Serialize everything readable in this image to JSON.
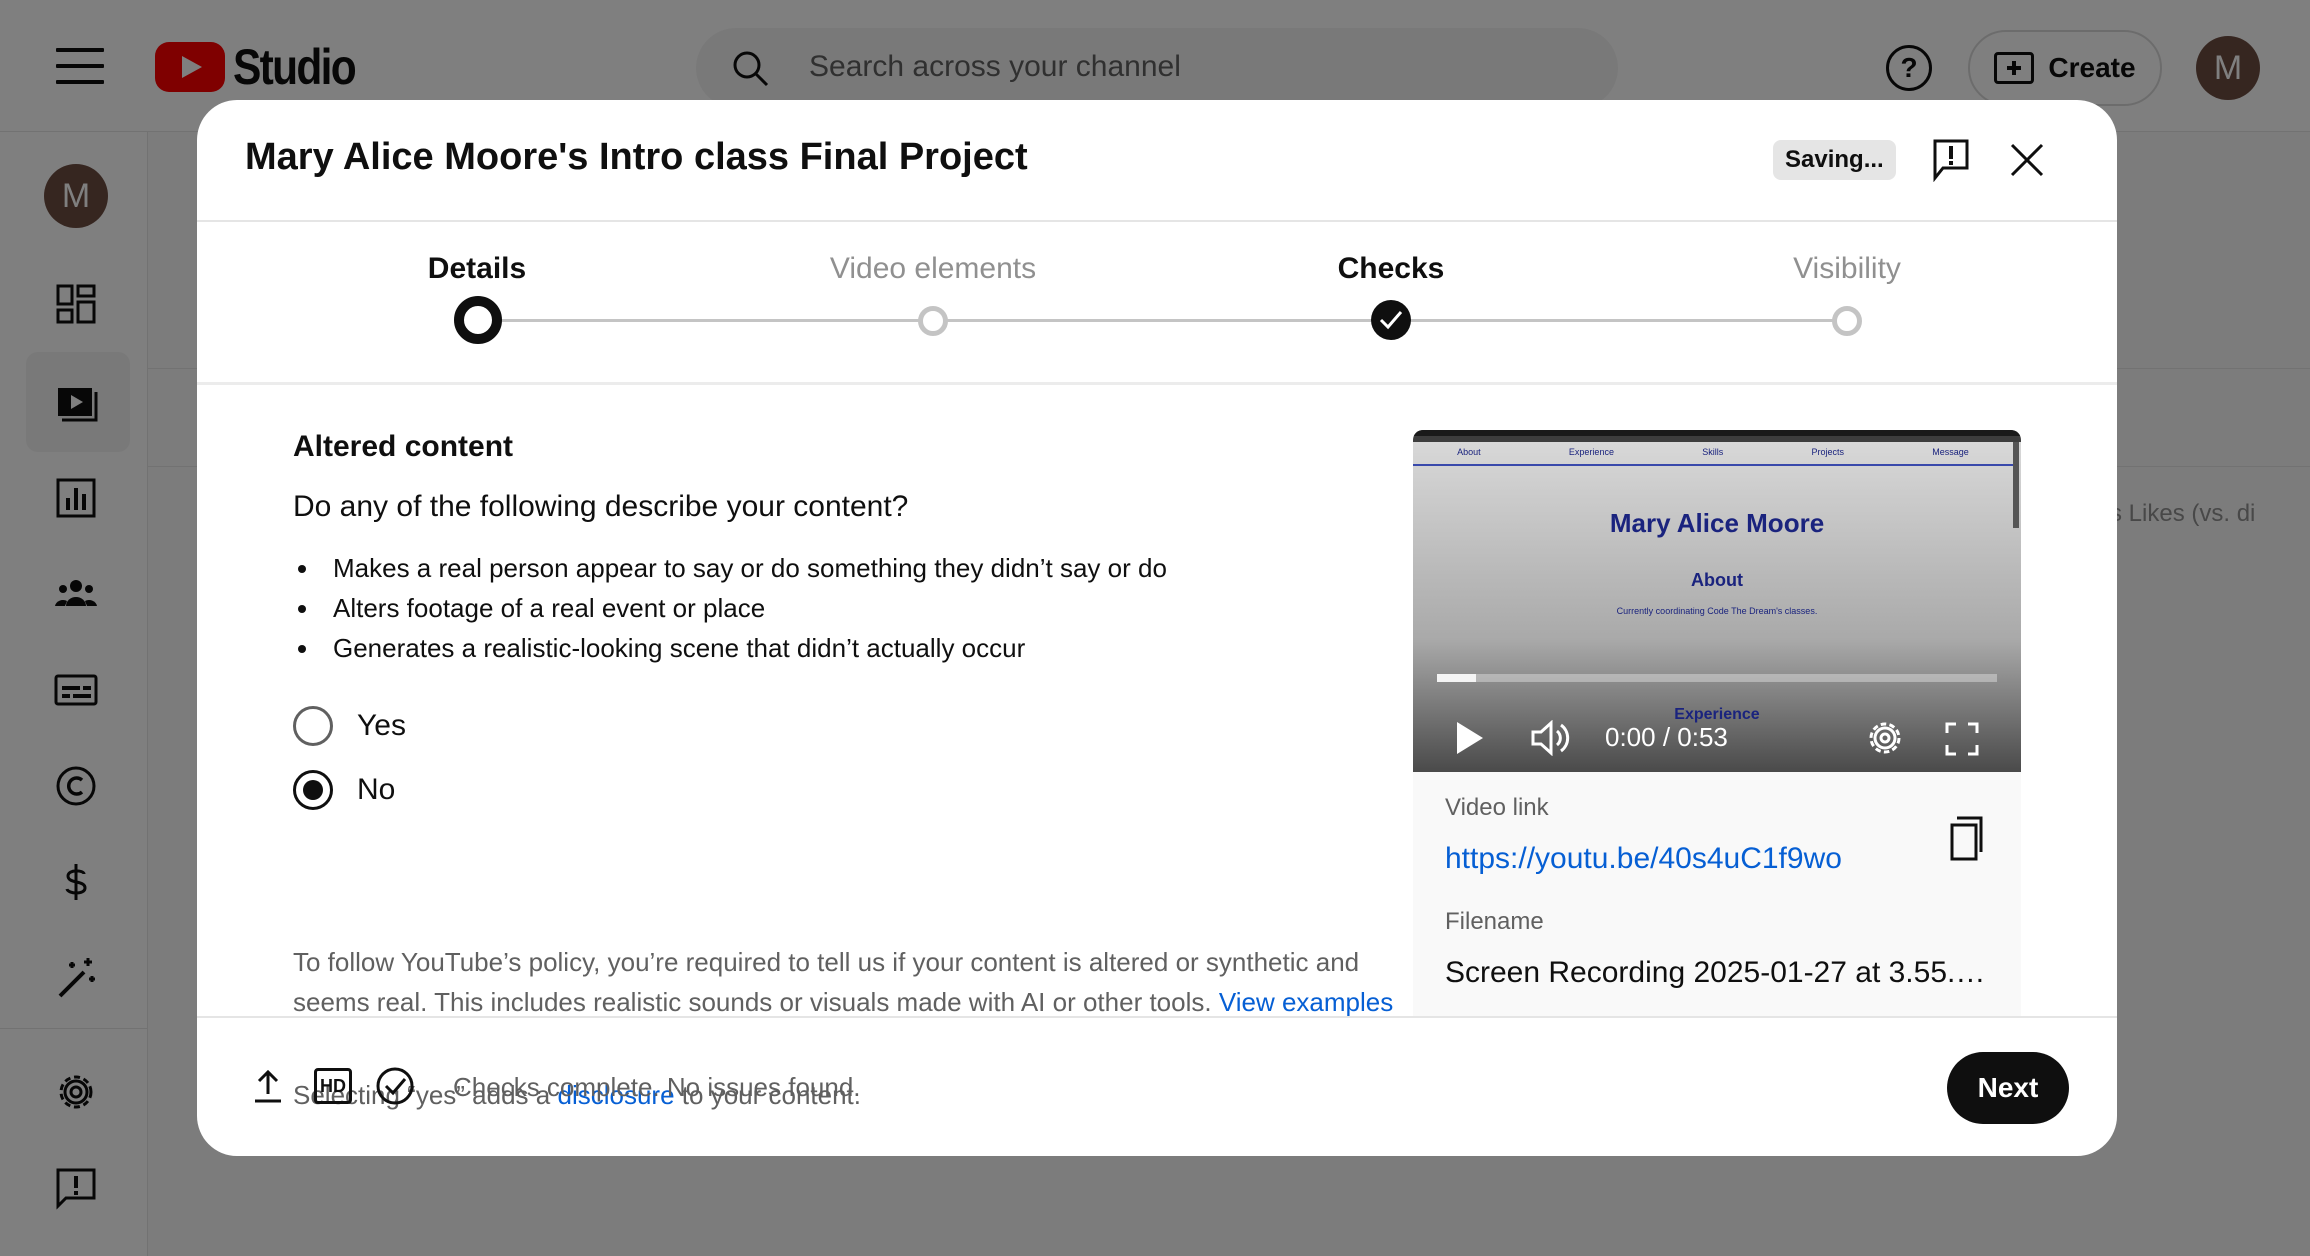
{
  "app": {
    "logo_text": "Studio",
    "search_placeholder": "Search across your channel",
    "create_label": "Create",
    "avatar_letter": "M",
    "help_glyph": "?",
    "bg_columns": "s     Likes (vs. di"
  },
  "sidebar": {
    "avatar_letter": "M",
    "items": [
      "dashboard-icon",
      "content-icon",
      "analytics-icon",
      "community-icon",
      "subtitles-icon",
      "copyright-icon",
      "earn-icon",
      "customization-icon",
      "settings-icon",
      "send-feedback-icon"
    ]
  },
  "dialog": {
    "title": "Mary Alice Moore's Intro class Final Project",
    "saving_label": "Saving...",
    "steps": [
      {
        "label": "Details",
        "state": "current"
      },
      {
        "label": "Video elements",
        "state": "pending"
      },
      {
        "label": "Checks",
        "state": "done"
      },
      {
        "label": "Visibility",
        "state": "pending"
      }
    ],
    "section_title": "Altered content",
    "question": "Do any of the following describe your content?",
    "bullets": [
      "Makes a real person appear to say or do something they didn’t say or do",
      "Alters footage of a real event or place",
      "Generates a realistic-looking scene that didn’t actually occur"
    ],
    "options": [
      {
        "label": "Yes",
        "selected": false
      },
      {
        "label": "No",
        "selected": true
      }
    ],
    "policy_text": "To follow YouTube’s policy, you’re required to tell us if your content is altered or synthetic and seems real. This includes realistic sounds or visuals made with AI or other tools.",
    "view_examples_label": "View examples",
    "disclosure_prefix": "Selecting “yes” adds a",
    "disclosure_link": "disclosure",
    "disclosure_suffix": "to your content."
  },
  "preview": {
    "site_nav": [
      "About",
      "Experience",
      "Skills",
      "Projects",
      "Message"
    ],
    "site_name": "Mary Alice Moore",
    "site_about": "About",
    "site_about_text": "Currently coordinating Code The Dream's classes.",
    "site_experience": "Experience",
    "progress": 0.07,
    "time": "0:00 / 0:53",
    "video_link_label": "Video link",
    "video_link": "https://youtu.be/40s4uC1f9wo",
    "filename_label": "Filename",
    "filename": "Screen Recording 2025-01-27 at 3.55.2..."
  },
  "footer": {
    "hd_label": "HD",
    "status": "Checks complete. No issues found.",
    "next_label": "Next"
  }
}
